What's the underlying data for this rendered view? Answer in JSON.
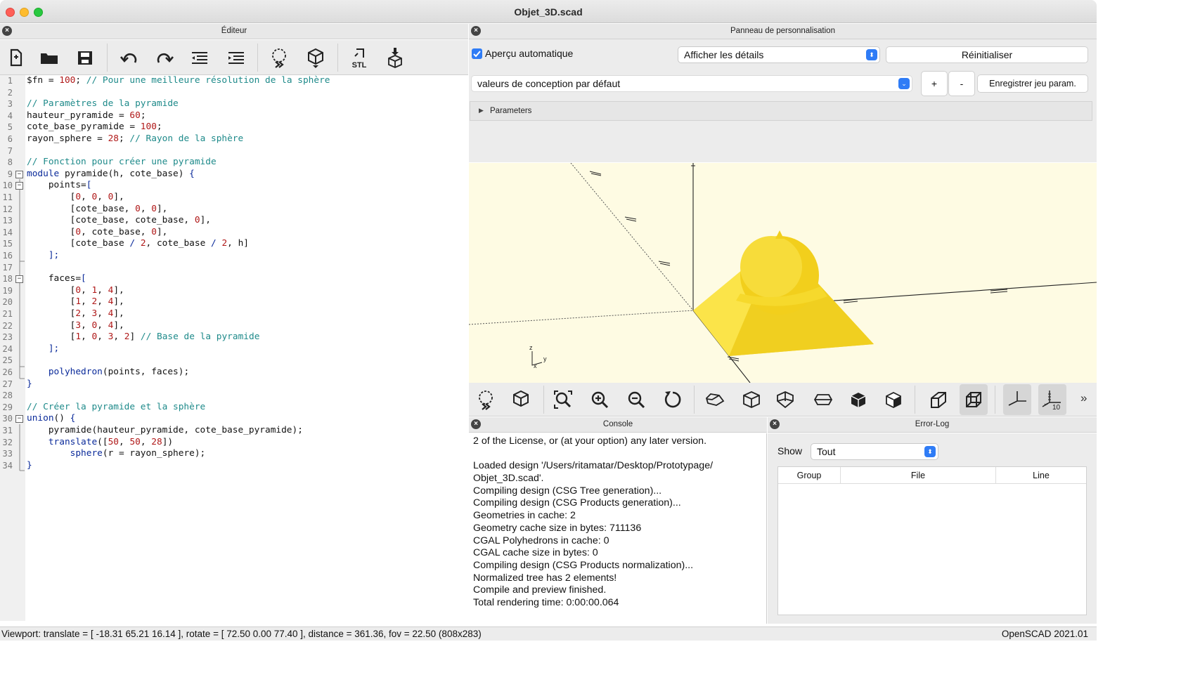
{
  "window": {
    "title": "Objet_3D.scad"
  },
  "editor": {
    "title": "Éditeur",
    "toolbar": [
      "new-file-icon",
      "open-folder-icon",
      "save-icon",
      "undo-icon",
      "redo-icon",
      "unindent-icon",
      "indent-icon",
      "preview-icon",
      "render-icon",
      "export-stl-icon",
      "send-to-print-icon"
    ],
    "stl_label": "STL",
    "lines": [
      {
        "n": "1",
        "fold": "",
        "tokens": [
          [
            "pl",
            "$fn = "
          ],
          [
            "nm",
            "100"
          ],
          [
            "pl",
            "; "
          ],
          [
            "cm",
            "// Pour une meilleure résolution de la sphère"
          ]
        ]
      },
      {
        "n": "2",
        "fold": "",
        "tokens": []
      },
      {
        "n": "3",
        "fold": "",
        "tokens": [
          [
            "cm",
            "// Paramètres de la pyramide"
          ]
        ]
      },
      {
        "n": "4",
        "fold": "",
        "tokens": [
          [
            "pl",
            "hauteur_pyramide = "
          ],
          [
            "nm",
            "60"
          ],
          [
            "pl",
            ";"
          ]
        ]
      },
      {
        "n": "5",
        "fold": "",
        "tokens": [
          [
            "pl",
            "cote_base_pyramide = "
          ],
          [
            "nm",
            "100"
          ],
          [
            "pl",
            ";"
          ]
        ]
      },
      {
        "n": "6",
        "fold": "",
        "tokens": [
          [
            "pl",
            "rayon_sphere = "
          ],
          [
            "nm",
            "28"
          ],
          [
            "pl",
            "; "
          ],
          [
            "cm",
            "// Rayon de la sphère"
          ]
        ]
      },
      {
        "n": "7",
        "fold": "",
        "tokens": []
      },
      {
        "n": "8",
        "fold": "",
        "tokens": [
          [
            "cm",
            "// Fonction pour créer une pyramide"
          ]
        ]
      },
      {
        "n": "9",
        "fold": "−",
        "tokens": [
          [
            "kw",
            "module"
          ],
          [
            "pl",
            " pyramide(h, cote_base) "
          ],
          [
            "kw",
            "{"
          ]
        ]
      },
      {
        "n": "10",
        "fold": "−",
        "tokens": [
          [
            "pl",
            "    points="
          ],
          [
            "kw",
            "["
          ]
        ]
      },
      {
        "n": "11",
        "fold": "",
        "tokens": [
          [
            "pl",
            "        ["
          ],
          [
            "nm",
            "0"
          ],
          [
            "pl",
            ", "
          ],
          [
            "nm",
            "0"
          ],
          [
            "pl",
            ", "
          ],
          [
            "nm",
            "0"
          ],
          [
            "pl",
            "],"
          ]
        ]
      },
      {
        "n": "12",
        "fold": "",
        "tokens": [
          [
            "pl",
            "        [cote_base, "
          ],
          [
            "nm",
            "0"
          ],
          [
            "pl",
            ", "
          ],
          [
            "nm",
            "0"
          ],
          [
            "pl",
            "],"
          ]
        ]
      },
      {
        "n": "13",
        "fold": "",
        "tokens": [
          [
            "pl",
            "        [cote_base, cote_base, "
          ],
          [
            "nm",
            "0"
          ],
          [
            "pl",
            "],"
          ]
        ]
      },
      {
        "n": "14",
        "fold": "",
        "tokens": [
          [
            "pl",
            "        ["
          ],
          [
            "nm",
            "0"
          ],
          [
            "pl",
            ", cote_base, "
          ],
          [
            "nm",
            "0"
          ],
          [
            "pl",
            "],"
          ]
        ]
      },
      {
        "n": "15",
        "fold": "",
        "tokens": [
          [
            "pl",
            "        [cote_base "
          ],
          [
            "kw",
            "/"
          ],
          [
            "pl",
            " "
          ],
          [
            "nm",
            "2"
          ],
          [
            "pl",
            ", cote_base "
          ],
          [
            "kw",
            "/"
          ],
          [
            "pl",
            " "
          ],
          [
            "nm",
            "2"
          ],
          [
            "pl",
            ", h]"
          ]
        ]
      },
      {
        "n": "16",
        "fold": "",
        "tokens": [
          [
            "pl",
            "    "
          ],
          [
            "kw",
            "];"
          ]
        ]
      },
      {
        "n": "17",
        "fold": "",
        "tokens": []
      },
      {
        "n": "18",
        "fold": "−",
        "tokens": [
          [
            "pl",
            "    faces="
          ],
          [
            "kw",
            "["
          ]
        ]
      },
      {
        "n": "19",
        "fold": "",
        "tokens": [
          [
            "pl",
            "        ["
          ],
          [
            "nm",
            "0"
          ],
          [
            "pl",
            ", "
          ],
          [
            "nm",
            "1"
          ],
          [
            "pl",
            ", "
          ],
          [
            "nm",
            "4"
          ],
          [
            "pl",
            "],"
          ]
        ]
      },
      {
        "n": "20",
        "fold": "",
        "tokens": [
          [
            "pl",
            "        ["
          ],
          [
            "nm",
            "1"
          ],
          [
            "pl",
            ", "
          ],
          [
            "nm",
            "2"
          ],
          [
            "pl",
            ", "
          ],
          [
            "nm",
            "4"
          ],
          [
            "pl",
            "],"
          ]
        ]
      },
      {
        "n": "21",
        "fold": "",
        "tokens": [
          [
            "pl",
            "        ["
          ],
          [
            "nm",
            "2"
          ],
          [
            "pl",
            ", "
          ],
          [
            "nm",
            "3"
          ],
          [
            "pl",
            ", "
          ],
          [
            "nm",
            "4"
          ],
          [
            "pl",
            "],"
          ]
        ]
      },
      {
        "n": "22",
        "fold": "",
        "tokens": [
          [
            "pl",
            "        ["
          ],
          [
            "nm",
            "3"
          ],
          [
            "pl",
            ", "
          ],
          [
            "nm",
            "0"
          ],
          [
            "pl",
            ", "
          ],
          [
            "nm",
            "4"
          ],
          [
            "pl",
            "],"
          ]
        ]
      },
      {
        "n": "23",
        "fold": "",
        "tokens": [
          [
            "pl",
            "        ["
          ],
          [
            "nm",
            "1"
          ],
          [
            "pl",
            ", "
          ],
          [
            "nm",
            "0"
          ],
          [
            "pl",
            ", "
          ],
          [
            "nm",
            "3"
          ],
          [
            "pl",
            ", "
          ],
          [
            "nm",
            "2"
          ],
          [
            "pl",
            "] "
          ],
          [
            "cm",
            "// Base de la pyramide"
          ]
        ]
      },
      {
        "n": "24",
        "fold": "",
        "tokens": [
          [
            "pl",
            "    "
          ],
          [
            "kw",
            "];"
          ]
        ]
      },
      {
        "n": "25",
        "fold": "",
        "tokens": []
      },
      {
        "n": "26",
        "fold": "",
        "tokens": [
          [
            "pl",
            "    "
          ],
          [
            "kw",
            "polyhedron"
          ],
          [
            "pl",
            "(points, faces);"
          ]
        ]
      },
      {
        "n": "27",
        "fold": "",
        "tokens": [
          [
            "kw",
            "}"
          ]
        ]
      },
      {
        "n": "28",
        "fold": "",
        "tokens": []
      },
      {
        "n": "29",
        "fold": "",
        "tokens": [
          [
            "cm",
            "// Créer la pyramide et la sphère"
          ]
        ]
      },
      {
        "n": "30",
        "fold": "−",
        "tokens": [
          [
            "kw",
            "union"
          ],
          [
            "pl",
            "() "
          ],
          [
            "kw",
            "{"
          ]
        ]
      },
      {
        "n": "31",
        "fold": "",
        "tokens": [
          [
            "pl",
            "    pyramide(hauteur_pyramide, cote_base_pyramide);"
          ]
        ]
      },
      {
        "n": "32",
        "fold": "",
        "tokens": [
          [
            "pl",
            "    "
          ],
          [
            "kw",
            "translate"
          ],
          [
            "pl",
            "(["
          ],
          [
            "nm",
            "50"
          ],
          [
            "pl",
            ", "
          ],
          [
            "nm",
            "50"
          ],
          [
            "pl",
            ", "
          ],
          [
            "nm",
            "28"
          ],
          [
            "pl",
            "])"
          ]
        ]
      },
      {
        "n": "33",
        "fold": "",
        "tokens": [
          [
            "pl",
            "        "
          ],
          [
            "kw",
            "sphere"
          ],
          [
            "pl",
            "(r = rayon_sphere);"
          ]
        ]
      },
      {
        "n": "34",
        "fold": "",
        "tokens": [
          [
            "kw",
            "}"
          ]
        ]
      }
    ]
  },
  "customizer": {
    "title": "Panneau de personnalisation",
    "auto_preview_label": "Aperçu automatique",
    "auto_preview_checked": true,
    "details_select": "Afficher les détails",
    "reset_label": "Réinitialiser",
    "preset_select": "valeurs de conception par défaut",
    "add_label": "+",
    "remove_label": "-",
    "save_preset_label": "Enregistrer jeu param.",
    "parameters_group": "Parameters"
  },
  "viewport": {
    "model_color": "#f7dc2e",
    "background": "#fefbe3",
    "toolbar": [
      "preview-icon",
      "render-icon",
      "view-all-icon",
      "zoom-in-icon",
      "zoom-out-icon",
      "reset-view-icon",
      "view-right-icon",
      "view-top-icon",
      "view-bottom-icon",
      "view-left-icon",
      "view-front-icon",
      "view-back-icon",
      "perspective-icon",
      "orthogonal-icon",
      "show-axes-icon",
      "show-scale-icon"
    ],
    "scale_label": "10",
    "overflow": "»"
  },
  "console": {
    "title": "Console",
    "lines": [
      "2 of the License, or (at your option) any later version.",
      "",
      "Loaded design '/Users/ritamatar/Desktop/Prototypage/",
      "Objet_3D.scad'.",
      "Compiling design (CSG Tree generation)...",
      "Compiling design (CSG Products generation)...",
      "Geometries in cache: 2",
      "Geometry cache size in bytes: 711136",
      "CGAL Polyhedrons in cache: 0",
      "CGAL cache size in bytes: 0",
      "Compiling design (CSG Products normalization)...",
      "Normalized tree has 2 elements!",
      "Compile and preview finished.",
      "Total rendering time: 0:00:00.064"
    ]
  },
  "errorlog": {
    "title": "Error-Log",
    "show_label": "Show",
    "show_value": "Tout",
    "columns": [
      "Group",
      "File",
      "Line"
    ]
  },
  "status": {
    "viewport_info": "Viewport: translate = [ -18.31 65.21 16.14 ], rotate = [ 72.50 0.00 77.40 ], distance = 361.36, fov = 22.50 (808x283)",
    "version": "OpenSCAD 2021.01"
  }
}
